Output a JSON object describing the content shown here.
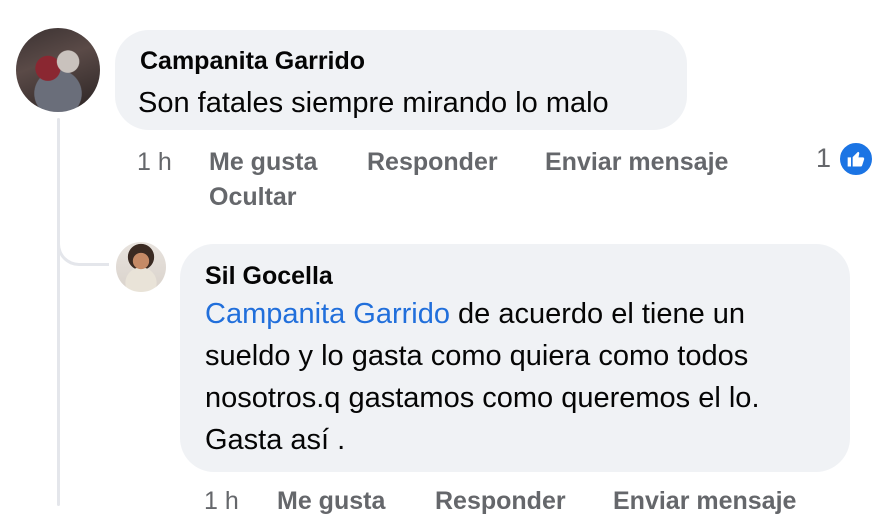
{
  "comments": [
    {
      "author": "Campanita Garrido",
      "text": "Son fatales siempre mirando lo malo",
      "time": "1 h",
      "like_label": "Me gusta",
      "reply_label": "Responder",
      "message_label": "Enviar mensaje",
      "hide_label": "Ocultar",
      "reaction_count": "1",
      "reaction_icon": "like-icon"
    },
    {
      "author": "Sil Gocella",
      "mention": "Campanita Garrido",
      "text": " de acuerdo el tiene un sueldo y lo gasta como quiera como todos nosotros.q gastamos como queremos el lo. Gasta así .",
      "time": "1 h",
      "like_label": "Me gusta",
      "reply_label": "Responder",
      "message_label": "Enviar mensaje"
    }
  ],
  "colors": {
    "bubble": "#f0f2f5",
    "mention": "#216fdb",
    "meta": "#65676b",
    "like": "#1b74e4"
  }
}
